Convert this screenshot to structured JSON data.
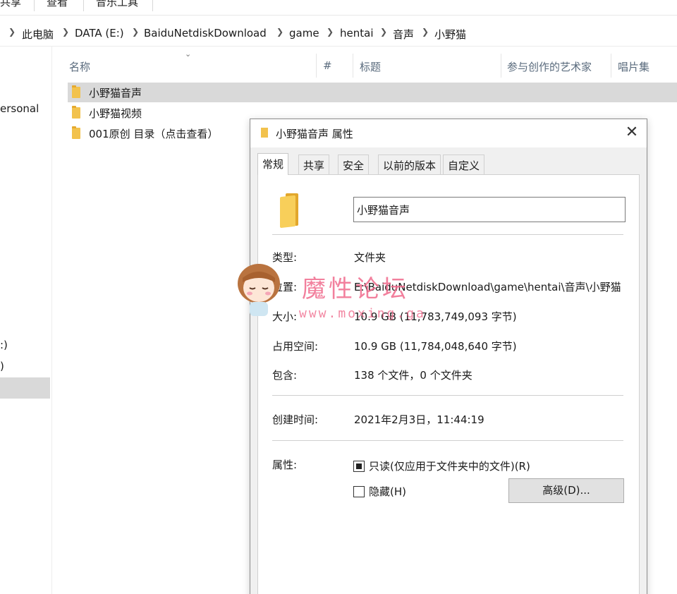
{
  "ribbon": {
    "tabs": [
      "共享",
      "查看",
      "音乐工具"
    ]
  },
  "address": {
    "crumbs": [
      "此电脑",
      "DATA (E:)",
      "BaiduNetdiskDownload",
      "game",
      "hentai",
      "音声",
      "小野猫"
    ]
  },
  "nav": {
    "item_personal": "ersonal",
    "item_drive1": ":)",
    "item_drive2": ")"
  },
  "columns": {
    "name": "名称",
    "number": "#",
    "title": "标题",
    "artists": "参与创作的艺术家",
    "album": "唱片集"
  },
  "files": [
    {
      "name": "小野猫音声",
      "selected": true
    },
    {
      "name": "小野猫视频",
      "selected": false
    },
    {
      "name": "001原创 目录（点击查看）",
      "selected": false
    }
  ],
  "dialog": {
    "title": "小野猫音声 属性",
    "close_glyph": "✕",
    "tabs": [
      "常规",
      "共享",
      "安全",
      "以前的版本",
      "自定义"
    ],
    "active_tab": "常规",
    "folder_name": "小野猫音声",
    "type_label": "类型:",
    "type_value": "文件夹",
    "location_label": "位置:",
    "location_value": "E:\\BaiduNetdiskDownload\\game\\hentai\\音声\\小野猫",
    "size_label": "大小:",
    "size_value": "10.9 GB (11,783,749,093 字节)",
    "disk_size_label": "占用空间:",
    "disk_size_value": "10.9 GB (11,784,048,640 字节)",
    "contains_label": "包含:",
    "contains_value": "138 个文件，0 个文件夹",
    "created_label": "创建时间:",
    "created_value": "2021年2月3日，11:44:19",
    "attributes_label": "属性:",
    "readonly_label": "只读(仅应用于文件夹中的文件)(R)",
    "hidden_label": "隐藏(H)",
    "advanced_button": "高级(D)..."
  },
  "watermark": {
    "title": "魔性论坛",
    "url": "www.moxing.ga"
  }
}
